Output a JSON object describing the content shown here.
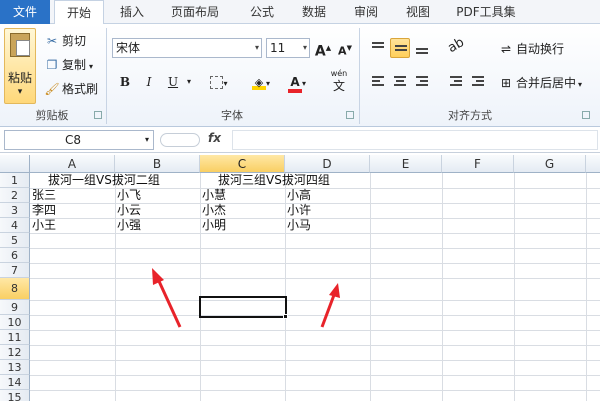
{
  "tabs": [
    "文件",
    "开始",
    "插入",
    "页面布局",
    "公式",
    "数据",
    "审阅",
    "视图",
    "PDF工具集"
  ],
  "clipboard": {
    "paste": "粘贴",
    "cut": "剪切",
    "copy": "复制",
    "format_painter": "格式刷",
    "group": "剪贴板"
  },
  "font": {
    "name": "宋体",
    "size": "11",
    "group": "字体",
    "bold": "B",
    "italic": "I",
    "underline": "U",
    "grow": "A",
    "shrink": "A",
    "font_color": "A",
    "wen": "wén",
    "wen_char": "文"
  },
  "alignment": {
    "wrap": "自动换行",
    "merge": "合并后居中",
    "group": "对齐方式"
  },
  "formula_bar": {
    "name_box": "C8",
    "fx": "fx",
    "content": ""
  },
  "columns": [
    "A",
    "B",
    "C",
    "D",
    "E",
    "F",
    "G"
  ],
  "selected_column": "C",
  "selected_row": "8",
  "rows": [
    "1",
    "2",
    "3",
    "4",
    "5",
    "6",
    "7",
    "8",
    "9",
    "10",
    "11",
    "12",
    "13",
    "14",
    "15"
  ],
  "cells": {
    "A1": "拔河一组VS拔河二组",
    "C1": "拔河三组VS拔河四组",
    "A2": "张三",
    "B2": "小飞",
    "C2": "小慧",
    "D2": "小高",
    "A3": "李四",
    "B3": "小云",
    "C3": "小杰",
    "D3": "小许",
    "A4": "小王",
    "B4": "小强",
    "C4": "小明",
    "D4": "小马"
  },
  "colors": {
    "arrow": "#e8232a",
    "file_tab": "#2a72c7",
    "selection_header": "#f9cf63",
    "highlight": "#ffd400",
    "font_red": "#e8232a"
  }
}
